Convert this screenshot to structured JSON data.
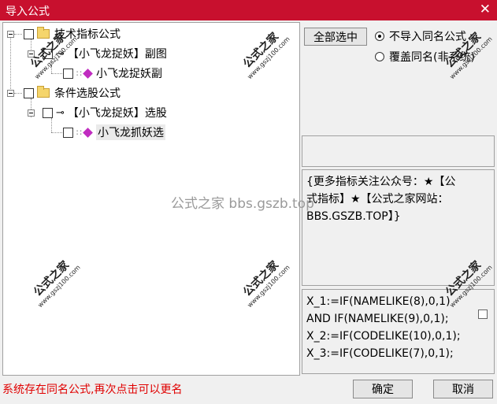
{
  "window": {
    "title": "导入公式",
    "close_glyph": "✕"
  },
  "tree": {
    "nodes": [
      {
        "label": "技术指标公式"
      },
      {
        "label": "【小飞龙捉妖】副图"
      },
      {
        "label": "小飞龙捉妖副"
      },
      {
        "label": "条件选股公式"
      },
      {
        "label": "【小飞龙捉妖】选股"
      },
      {
        "label": "小飞龙抓妖选"
      }
    ],
    "icons": {
      "folder": "folder-icon",
      "key": "key-icon",
      "formula": "formula-gem-icon"
    }
  },
  "toolbar": {
    "select_all_label": "全部选中"
  },
  "options": {
    "radio1": "不导入同名公式",
    "radio2": "覆盖同名(非系统)",
    "selected": "radio1"
  },
  "info": {
    "lines": [
      "{更多指标关注公众号：★【公",
      "式指标】★【公式之家网站：",
      "BBS.GSZB.TOP】}"
    ]
  },
  "code": {
    "lines": [
      "X_1:=IF(NAMELIKE(8),0,1)",
      "AND IF(NAMELIKE(9),0,1);",
      "X_2:=IF(CODELIKE(10),0,1);",
      "X_3:=IF(CODELIKE(7),0,1);"
    ]
  },
  "status": {
    "message": "系统存在同名公式,再次点击可以更名"
  },
  "footer": {
    "ok_label": "确定",
    "cancel_label": "取消"
  },
  "watermark": {
    "main": "公式之家 bbs.gszb.top",
    "stamp_cn": "公式之家",
    "stamp_url": "www.gszj100.com"
  },
  "colors": {
    "titlebar": "#c8102e",
    "status_text": "#e00000",
    "gem": "#c02cc0"
  }
}
